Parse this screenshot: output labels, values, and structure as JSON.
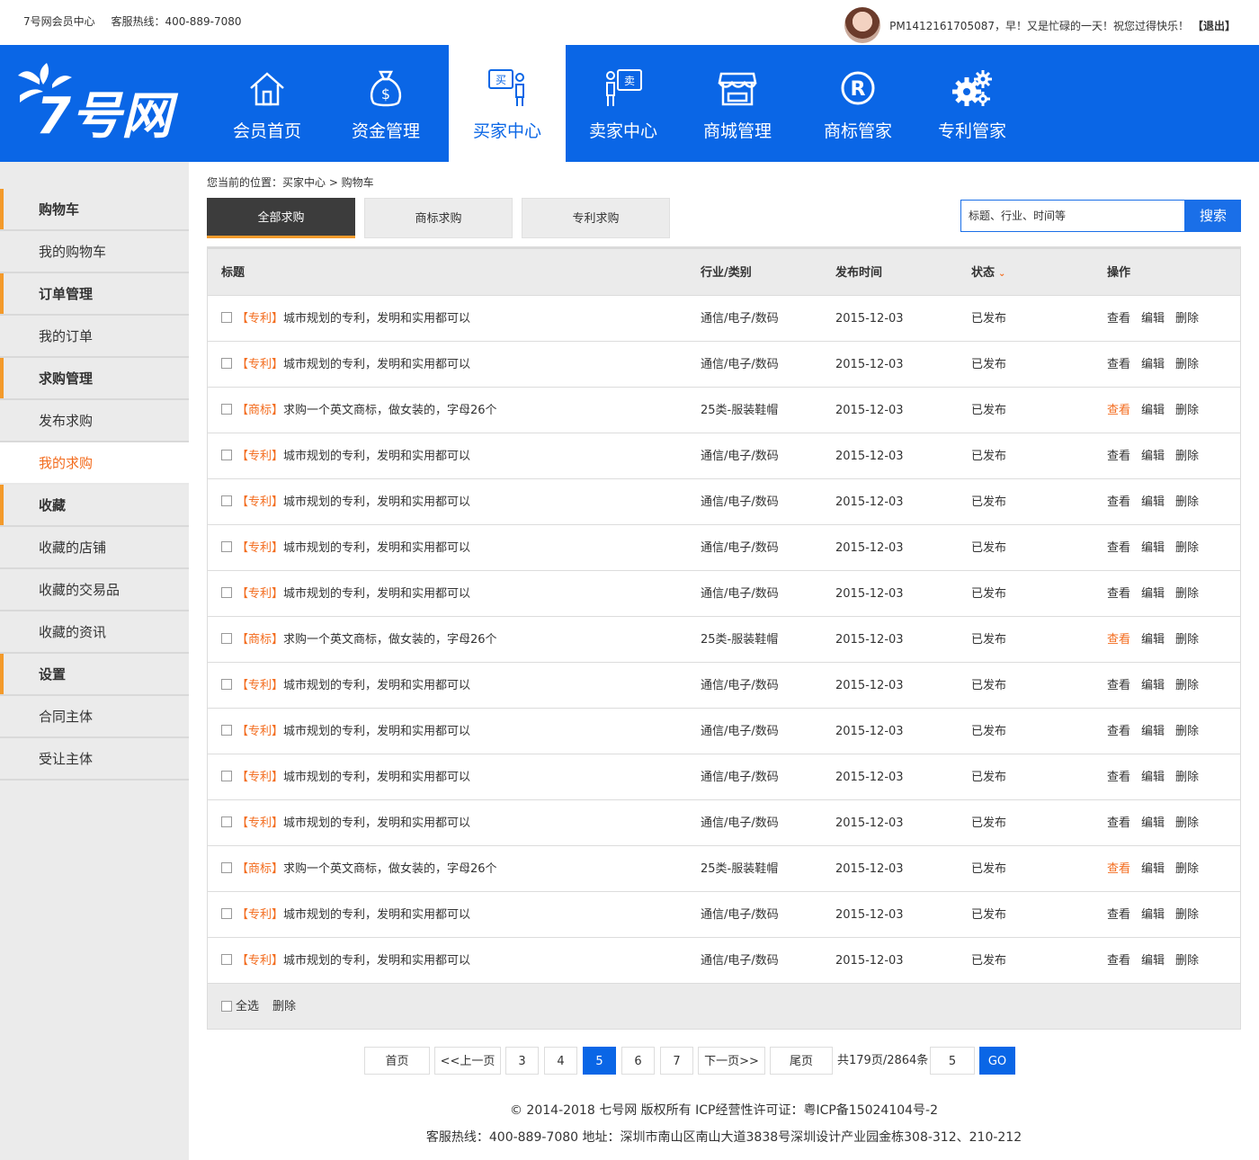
{
  "topbar": {
    "site_name": "7号网会员中心",
    "hotline": "客服热线：400-889-7080",
    "greeting": "PM1412161705087，早！又是忙碌的一天！祝您过得快乐！",
    "logout": "【退出】"
  },
  "logo_text": "7号网",
  "nav": [
    {
      "label": "会员首页",
      "icon": "home-icon"
    },
    {
      "label": "资金管理",
      "icon": "money-bag-icon"
    },
    {
      "label": "买家中心",
      "icon": "buyer-icon",
      "active": true
    },
    {
      "label": "卖家中心",
      "icon": "seller-icon"
    },
    {
      "label": "商城管理",
      "icon": "store-icon"
    },
    {
      "label": "商标管家",
      "icon": "registered-icon"
    },
    {
      "label": "专利管家",
      "icon": "gears-icon"
    }
  ],
  "sidebar": [
    {
      "label": "购物车",
      "group": true
    },
    {
      "label": "我的购物车"
    },
    {
      "label": "订单管理",
      "group": true
    },
    {
      "label": "我的订单"
    },
    {
      "label": "求购管理",
      "group": true
    },
    {
      "label": "发布求购"
    },
    {
      "label": "我的求购",
      "current": true
    },
    {
      "label": "收藏",
      "group": true
    },
    {
      "label": "收藏的店铺"
    },
    {
      "label": "收藏的交易品"
    },
    {
      "label": "收藏的资讯"
    },
    {
      "label": "设置",
      "group": true
    },
    {
      "label": "合同主体"
    },
    {
      "label": "受让主体"
    }
  ],
  "breadcrumb": "您当前的位置：买家中心 >  购物车",
  "tabs": [
    "全部求购",
    "商标求购",
    "专利求购"
  ],
  "search": {
    "placeholder": "标题、行业、时间等",
    "button": "搜索"
  },
  "table": {
    "headers": {
      "title": "标题",
      "industry": "行业/类别",
      "date": "发布时间",
      "status": "状态",
      "ops": "操作"
    },
    "actions": {
      "view": "查看",
      "edit": "编辑",
      "delete": "删除"
    },
    "rows": [
      {
        "tag": "【专利】",
        "title": "城市规划的专利，发明和实用都可以",
        "industry": "通信/电子/数码",
        "date": "2015-12-03",
        "status": "已发布",
        "hl": false
      },
      {
        "tag": "【专利】",
        "title": "城市规划的专利，发明和实用都可以",
        "industry": "通信/电子/数码",
        "date": "2015-12-03",
        "status": "已发布",
        "hl": false
      },
      {
        "tag": "【商标】",
        "title": "求购一个英文商标，做女装的，字母26个",
        "industry": "25类-服装鞋帽",
        "date": "2015-12-03",
        "status": "已发布",
        "hl": true
      },
      {
        "tag": "【专利】",
        "title": "城市规划的专利，发明和实用都可以",
        "industry": "通信/电子/数码",
        "date": "2015-12-03",
        "status": "已发布",
        "hl": false
      },
      {
        "tag": "【专利】",
        "title": "城市规划的专利，发明和实用都可以",
        "industry": "通信/电子/数码",
        "date": "2015-12-03",
        "status": "已发布",
        "hl": false
      },
      {
        "tag": "【专利】",
        "title": "城市规划的专利，发明和实用都可以",
        "industry": "通信/电子/数码",
        "date": "2015-12-03",
        "status": "已发布",
        "hl": false
      },
      {
        "tag": "【专利】",
        "title": "城市规划的专利，发明和实用都可以",
        "industry": "通信/电子/数码",
        "date": "2015-12-03",
        "status": "已发布",
        "hl": false
      },
      {
        "tag": "【商标】",
        "title": "求购一个英文商标，做女装的，字母26个",
        "industry": "25类-服装鞋帽",
        "date": "2015-12-03",
        "status": "已发布",
        "hl": true
      },
      {
        "tag": "【专利】",
        "title": "城市规划的专利，发明和实用都可以",
        "industry": "通信/电子/数码",
        "date": "2015-12-03",
        "status": "已发布",
        "hl": false
      },
      {
        "tag": "【专利】",
        "title": "城市规划的专利，发明和实用都可以",
        "industry": "通信/电子/数码",
        "date": "2015-12-03",
        "status": "已发布",
        "hl": false
      },
      {
        "tag": "【专利】",
        "title": "城市规划的专利，发明和实用都可以",
        "industry": "通信/电子/数码",
        "date": "2015-12-03",
        "status": "已发布",
        "hl": false
      },
      {
        "tag": "【专利】",
        "title": "城市规划的专利，发明和实用都可以",
        "industry": "通信/电子/数码",
        "date": "2015-12-03",
        "status": "已发布",
        "hl": false
      },
      {
        "tag": "【商标】",
        "title": "求购一个英文商标，做女装的，字母26个",
        "industry": "25类-服装鞋帽",
        "date": "2015-12-03",
        "status": "已发布",
        "hl": true
      },
      {
        "tag": "【专利】",
        "title": "城市规划的专利，发明和实用都可以",
        "industry": "通信/电子/数码",
        "date": "2015-12-03",
        "status": "已发布",
        "hl": false
      },
      {
        "tag": "【专利】",
        "title": "城市规划的专利，发明和实用都可以",
        "industry": "通信/电子/数码",
        "date": "2015-12-03",
        "status": "已发布",
        "hl": false
      }
    ],
    "footer": {
      "select_all": "全选",
      "delete": "删除"
    }
  },
  "pager": {
    "first": "首页",
    "prev": "<<上一页",
    "pages": [
      "3",
      "4",
      "5",
      "6",
      "7"
    ],
    "current": "5",
    "next": "下一页>>",
    "last": "尾页",
    "total": "共179页/2864条",
    "jump_value": "5",
    "go": "GO"
  },
  "footer": {
    "copyright": "© 2014-2018 七号网 版权所有 ICP经营性许可证：粤ICP备15024104号-2",
    "contact": "客服热线：400-889-7080  地址：深圳市南山区南山大道3838号深圳设计产业园金栋308-312、210-212"
  },
  "colors": {
    "brand_blue": "#0a66e6",
    "accent_orange": "#f36c1e",
    "sidebar_marker": "#f39a2b"
  }
}
